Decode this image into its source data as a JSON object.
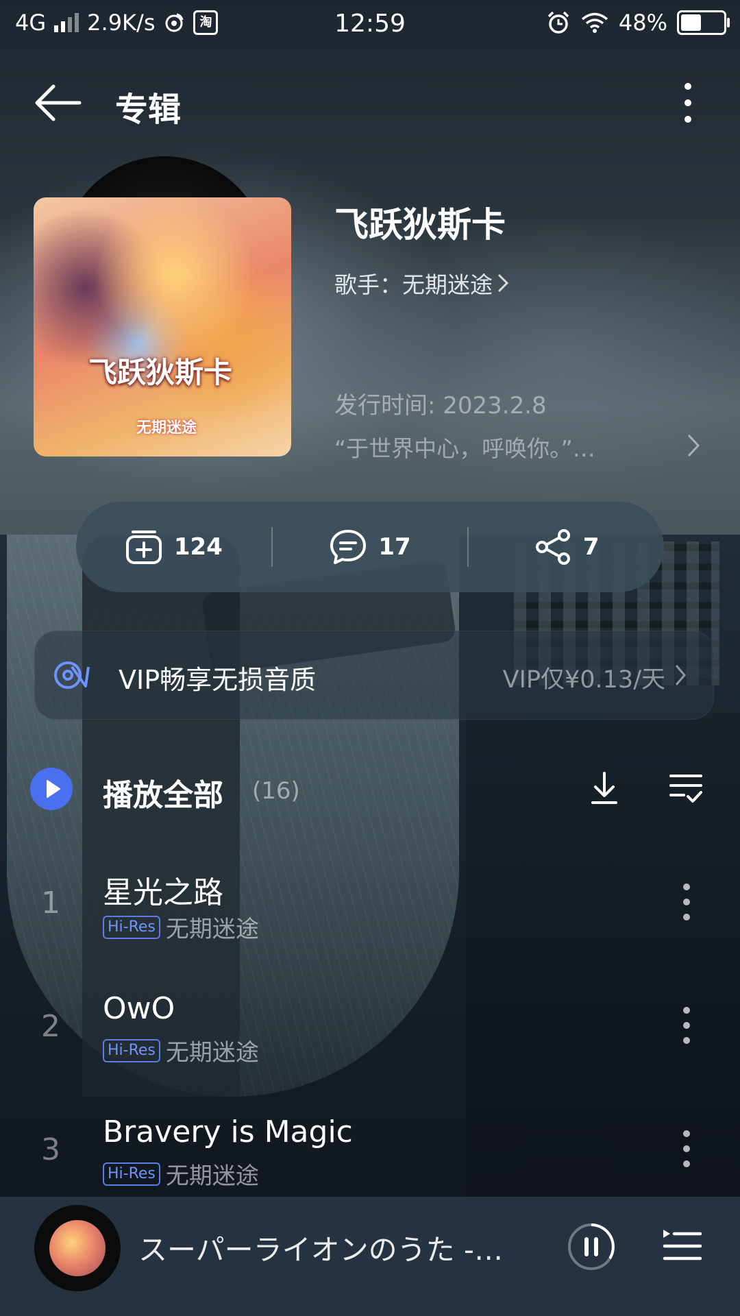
{
  "status_bar": {
    "network": "4G",
    "speed": "2.9K/s",
    "taobao": "淘",
    "time": "12:59",
    "battery": "48%",
    "battery_level": 0.48
  },
  "header": {
    "title": "专辑"
  },
  "album": {
    "title": "飞跃狄斯卡",
    "artist_label": "歌手：无期迷途",
    "release_date": "发行时间: 2023.2.8",
    "description": "“于世界中心，呼唤你。”…",
    "cover_text": "飞跃狄斯卡",
    "cover_sub": "无期迷途"
  },
  "actions": {
    "collect_count": "124",
    "comment_count": "17",
    "share_count": "7"
  },
  "vip": {
    "text": "VIP畅享无损音质",
    "price": "VIP仅¥0.13/天"
  },
  "play_all": {
    "label": "播放全部",
    "count": "(16)"
  },
  "songs": [
    {
      "index": "1",
      "title": "星光之路",
      "badge": "Hi-Res",
      "artist": "无期迷途"
    },
    {
      "index": "2",
      "title": "OwO",
      "badge": "Hi-Res",
      "artist": "无期迷途"
    },
    {
      "index": "3",
      "title": "Bravery is Magic",
      "badge": "Hi-Res",
      "artist": "无期迷途"
    }
  ],
  "mini_player": {
    "now_playing": "スーパーライオンのうた -…"
  },
  "colors": {
    "accent": "#4a6ff0",
    "hires": "#6f93ff"
  }
}
